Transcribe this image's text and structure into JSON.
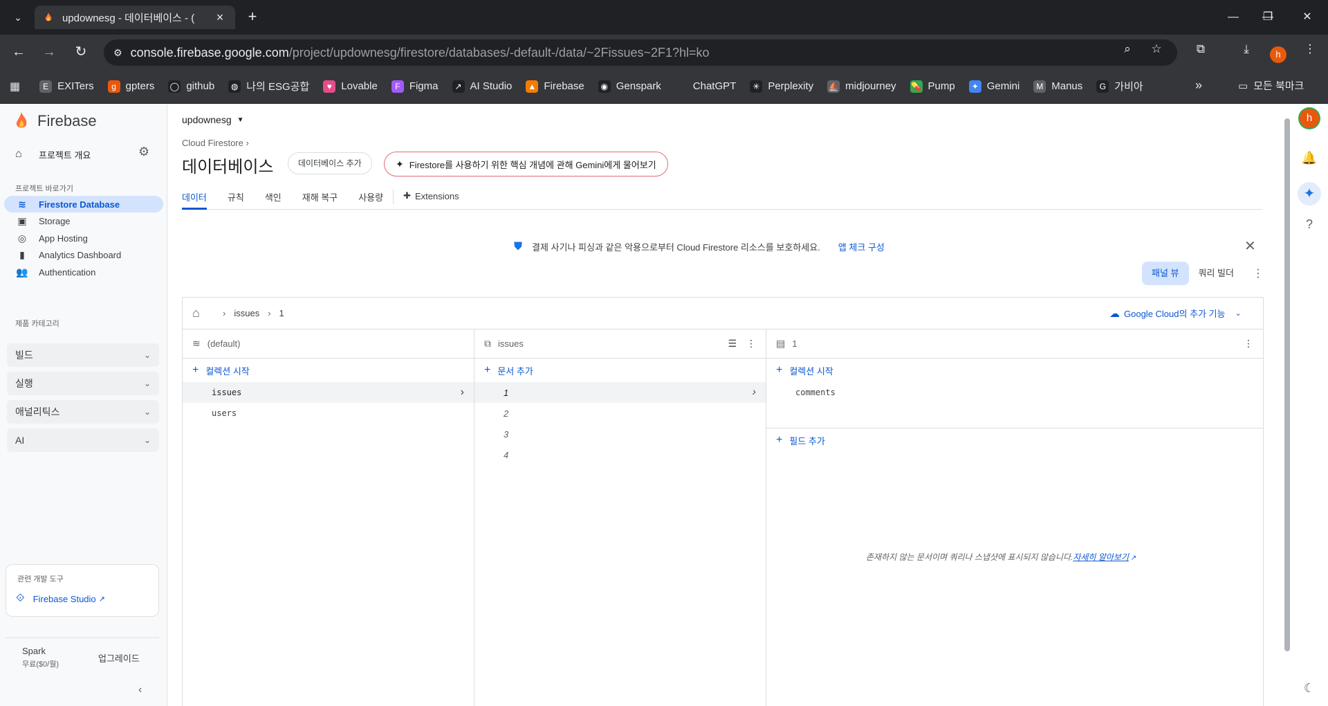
{
  "browser": {
    "tab_title": "updownesg - 데이터베이스 - (",
    "url_host": "console.firebase.google.com",
    "url_path": "/project/updownesg/firestore/databases/-default-/data/~2Fissues~2F1?hl=ko",
    "profile_initial": "h",
    "bookmarks": [
      {
        "label": "EXITers",
        "color": "#5f6368",
        "glyph": "E"
      },
      {
        "label": "gpters",
        "color": "#ea580c",
        "glyph": "g"
      },
      {
        "label": "github",
        "color": "#202124",
        "glyph": "◯"
      },
      {
        "label": "나의 ESG공합",
        "color": "#202124",
        "glyph": "◍"
      },
      {
        "label": "Lovable",
        "color": "#e44d8a",
        "glyph": "♥"
      },
      {
        "label": "Figma",
        "color": "#a259ff",
        "glyph": "F"
      },
      {
        "label": "AI Studio",
        "color": "#202124",
        "glyph": "↗"
      },
      {
        "label": "Firebase",
        "color": "#f57c00",
        "glyph": "▲"
      },
      {
        "label": "Genspark",
        "color": "#202124",
        "glyph": "◉"
      },
      {
        "label": "ChatGPT",
        "color": "#35363a",
        "glyph": ""
      },
      {
        "label": "Perplexity",
        "color": "#202124",
        "glyph": "✳"
      },
      {
        "label": "midjourney",
        "color": "#5f6368",
        "glyph": "⛵"
      },
      {
        "label": "Pump",
        "color": "#34a853",
        "glyph": "💊"
      },
      {
        "label": "Gemini",
        "color": "#4285f4",
        "glyph": "✦"
      },
      {
        "label": "Manus",
        "color": "#5f6368",
        "glyph": "M"
      },
      {
        "label": "가비아",
        "color": "#202124",
        "glyph": "G"
      }
    ],
    "all_bookmarks": "모든 북마크"
  },
  "sidebar": {
    "brand": "Firebase",
    "project_overview": "프로젝트 개요",
    "shortcuts_label": "프로젝트 바로가기",
    "items": [
      {
        "label": "Firestore Database",
        "icon": "firestore-icon",
        "glyph": "≋"
      },
      {
        "label": "Storage",
        "icon": "storage-icon",
        "glyph": "▣"
      },
      {
        "label": "App Hosting",
        "icon": "hosting-icon",
        "glyph": "◎"
      },
      {
        "label": "Analytics Dashboard",
        "icon": "analytics-icon",
        "glyph": "▮"
      },
      {
        "label": "Authentication",
        "icon": "people-icon",
        "glyph": "👥"
      }
    ],
    "category_label": "제품 카테고리",
    "categories": [
      "빌드",
      "실행",
      "애널리틱스",
      "AI"
    ],
    "devtools_title": "관련 개발 도구",
    "studio_link": "Firebase Studio",
    "plan_name": "Spark",
    "plan_price": "무료($0/월)",
    "upgrade": "업그레이드"
  },
  "main": {
    "project": "updownesg",
    "breadcrumb": "Cloud Firestore",
    "title": "데이터베이스",
    "add_database": "데이터베이스 추가",
    "gemini_prompt": "Firestore를 사용하기 위한 핵심 개념에 관해 Gemini에게 물어보기",
    "tabs": [
      "데이터",
      "규칙",
      "색인",
      "재해 복구",
      "사용량"
    ],
    "extensions_tab": "Extensions",
    "banner_text": "결제 사기나 피싱과 같은 악용으로부터 Cloud Firestore 리소스를 보호하세요.",
    "banner_link": "앱 체크 구성",
    "view_panel": "패널 뷰",
    "view_query": "쿼리 빌더",
    "path": [
      "issues",
      "1"
    ],
    "gcloud_more": "Google Cloud의 추가 기능",
    "col1": {
      "header": "(default)",
      "add": "컬렉션 시작",
      "items": [
        "issues",
        "users"
      ]
    },
    "col2": {
      "header": "issues",
      "add": "문서 추가",
      "items": [
        "1",
        "2",
        "3",
        "4"
      ]
    },
    "col3": {
      "header": "1",
      "add_collection": "컬렉션 시작",
      "subcollections": [
        "comments"
      ],
      "add_field": "필드 추가",
      "notice": "존재하지 않는 문서이며 쿼리나 스냅샷에 표시되지 않습니다.",
      "learn_more": "자세히 알아보기"
    }
  }
}
